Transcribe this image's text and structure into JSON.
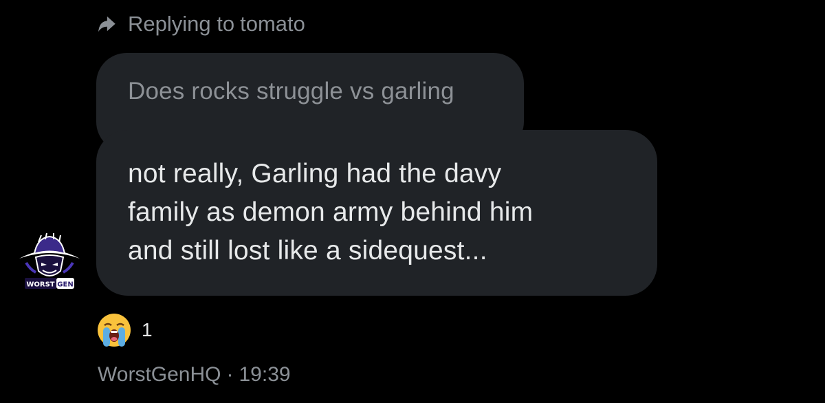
{
  "reply": {
    "prefix": "Replying to",
    "username": "tomato"
  },
  "quoted_message": {
    "text": "Does rocks struggle vs garling"
  },
  "message": {
    "lines": [
      "not really, Garling had the davy",
      "family as demon army behind him",
      "and still lost like a sidequest..."
    ]
  },
  "avatar": {
    "logo_text_left": "WORST",
    "logo_text_right": "GEN"
  },
  "reaction": {
    "emoji": "loudly-crying-face",
    "count": "1"
  },
  "meta": {
    "sender": "WorstGenHQ",
    "separator": "·",
    "time": "19:39"
  },
  "colors": {
    "background": "#000000",
    "bubble": "#202327",
    "muted_text": "#8b9096",
    "primary_text": "#e7e9ea"
  }
}
